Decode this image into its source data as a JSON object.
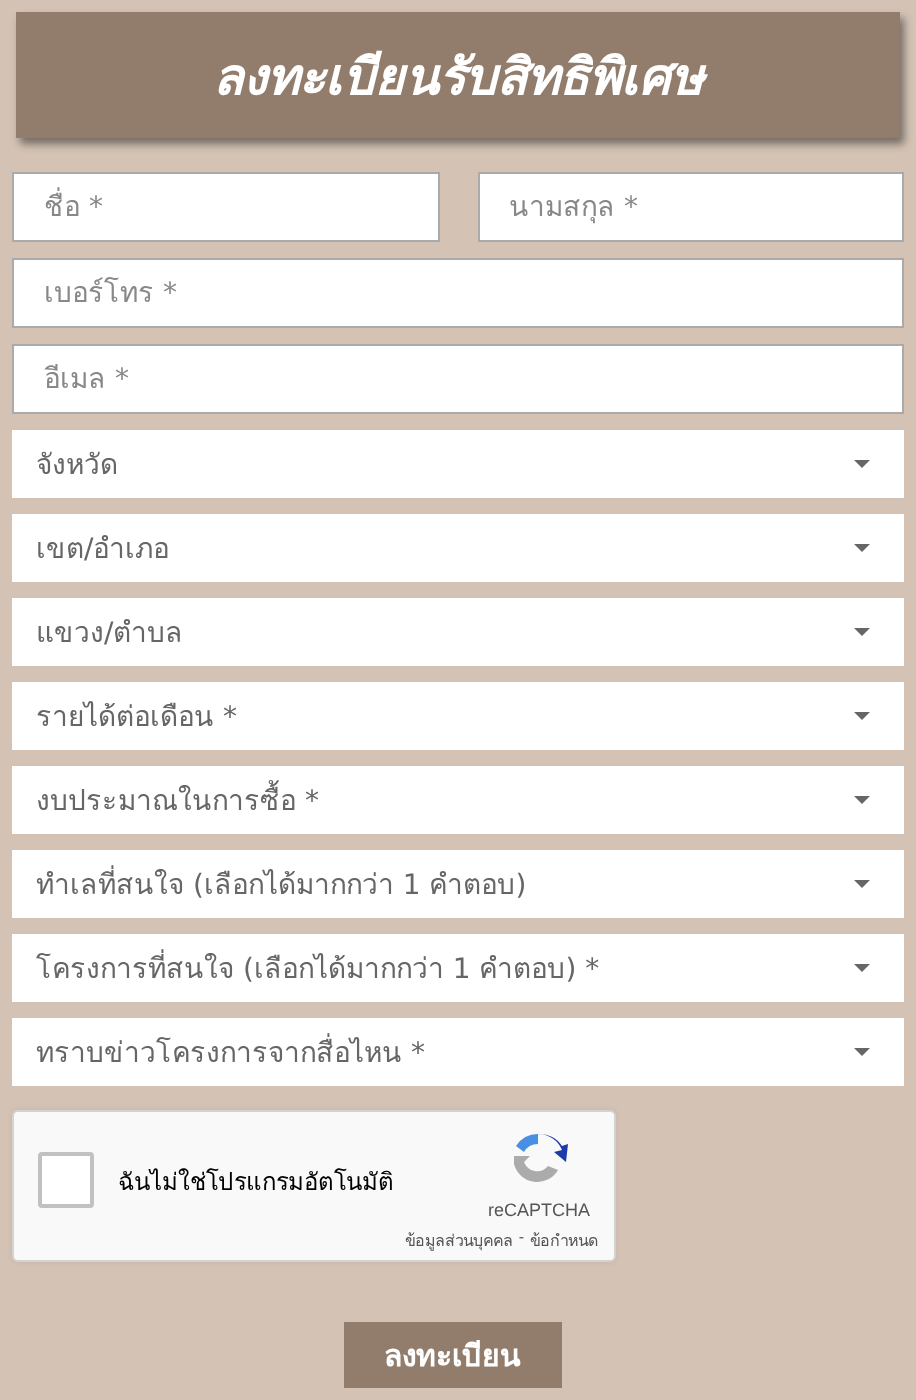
{
  "title": "ลงทะเบียนรับสิทธิพิเศษ",
  "rows": [
    [
      {
        "kind": "input",
        "placeholder": "ชื่อ *"
      },
      {
        "kind": "input",
        "placeholder": "นามสกุล *"
      }
    ],
    [
      {
        "kind": "input",
        "placeholder": "เบอร์โทร *"
      }
    ],
    [
      {
        "kind": "input",
        "placeholder": "อีเมล *"
      }
    ],
    [
      {
        "kind": "select",
        "label": "จังหวัด"
      }
    ],
    [
      {
        "kind": "select",
        "label": "เขต/อำเภอ"
      }
    ],
    [
      {
        "kind": "select",
        "label": "แขวง/ตำบล"
      }
    ],
    [
      {
        "kind": "select",
        "label": "รายได้ต่อเดือน *"
      }
    ],
    [
      {
        "kind": "select",
        "label": "งบประมาณในการซื้อ *"
      }
    ],
    [
      {
        "kind": "select",
        "label": "ทำเลที่สนใจ (เลือกได้มากกว่า 1 คำตอบ)"
      }
    ],
    [
      {
        "kind": "select",
        "label": "โครงการที่สนใจ (เลือกได้มากกว่า 1 คำตอบ) *"
      }
    ],
    [
      {
        "kind": "select",
        "label": "ทราบข่าวโครงการจากสื่อไหน *"
      }
    ]
  ],
  "captcha": {
    "checked": false,
    "label": "ฉันไม่ใช่โปรแกรมอัตโนมัติ",
    "brand": "reCAPTCHA",
    "privacy_link": "ข้อมูลส่วนบุคคล",
    "separator": "-",
    "terms_link": "ข้อกำหนด"
  },
  "submit_button": "ลงทะเบียน"
}
